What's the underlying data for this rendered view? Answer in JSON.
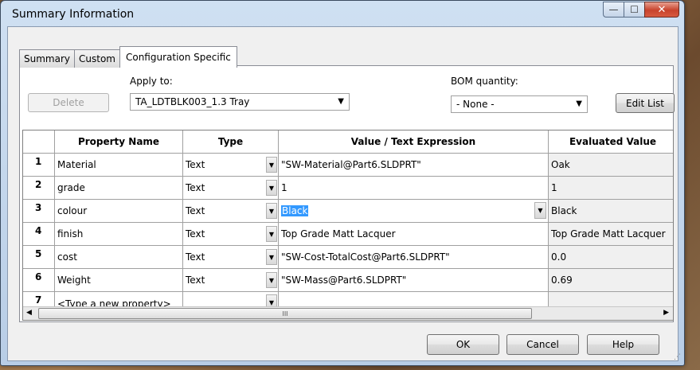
{
  "window": {
    "title": "Summary Information"
  },
  "title_controls": {
    "minimize": "—",
    "maximize": "☐",
    "close": "✕"
  },
  "tabs": [
    {
      "label": "Summary"
    },
    {
      "label": "Custom"
    },
    {
      "label": "Configuration Specific"
    }
  ],
  "toolbar": {
    "delete_label": "Delete",
    "apply_to_label": "Apply to:",
    "apply_to_value": "TA_LDTBLK003_1.3 Tray",
    "bom_label": "BOM quantity:",
    "bom_value": "- None -",
    "edit_list_label": "Edit List"
  },
  "grid": {
    "headers": [
      "",
      "Property Name",
      "Type",
      "Value / Text Expression",
      "Evaluated Value"
    ],
    "rows": [
      {
        "num": "1",
        "name": "Material",
        "type": "Text",
        "value": "\"SW-Material@Part6.SLDPRT\"",
        "evaluated": "Oak"
      },
      {
        "num": "2",
        "name": "grade",
        "type": "Text",
        "value": "1",
        "evaluated": "1"
      },
      {
        "num": "3",
        "name": "colour",
        "type": "Text",
        "value": "Black",
        "evaluated": "Black"
      },
      {
        "num": "4",
        "name": "finish",
        "type": "Text",
        "value": "Top Grade Matt Lacquer",
        "evaluated": "Top Grade Matt Lacquer"
      },
      {
        "num": "5",
        "name": "cost",
        "type": "Text",
        "value": "\"SW-Cost-TotalCost@Part6.SLDPRT\"",
        "evaluated": "0.0"
      },
      {
        "num": "6",
        "name": "Weight",
        "type": "Text",
        "value": "\"SW-Mass@Part6.SLDPRT\"",
        "evaluated": "0.69"
      },
      {
        "num": "7",
        "name": "<Type a new property>",
        "type": "",
        "value": "",
        "evaluated": ""
      }
    ],
    "selected_row_index": 2,
    "scroll_grip": "III"
  },
  "footer": {
    "ok_label": "OK",
    "cancel_label": "Cancel",
    "help_label": "Help"
  },
  "icons": {
    "dropdown": "▼",
    "scroll_left": "◀",
    "scroll_right": "▶",
    "resize_grip": "⋰"
  },
  "colors": {
    "selection": "#3399ff",
    "close_button": "#c8422c"
  }
}
